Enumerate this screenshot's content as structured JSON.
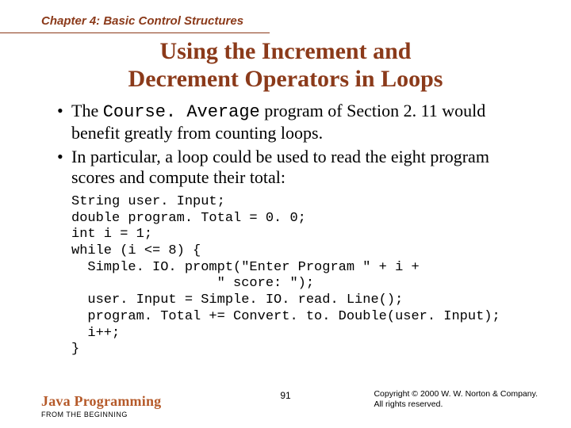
{
  "chapter": "Chapter 4: Basic Control Structures",
  "title_line1": "Using the Increment and",
  "title_line2": "Decrement Operators in Loops",
  "bullet1_pre": "The ",
  "bullet1_code": "Course. Average",
  "bullet1_post": " program of Section 2. 11 would benefit greatly from counting loops.",
  "bullet2": "In particular, a loop could be used to read the eight program scores and compute their total:",
  "code": "String user. Input;\ndouble program. Total = 0. 0;\nint i = 1;\nwhile (i <= 8) {\n  Simple. IO. prompt(\"Enter Program \" + i +\n                  \" score: \");\n  user. Input = Simple. IO. read. Line();\n  program. Total += Convert. to. Double(user. Input);\n  i++;\n}",
  "footer": {
    "brand": "Java Programming",
    "subbrand": "FROM THE BEGINNING",
    "page": "91",
    "copyright1": "Copyright © 2000 W. W. Norton & Company.",
    "copyright2": "All rights reserved."
  }
}
